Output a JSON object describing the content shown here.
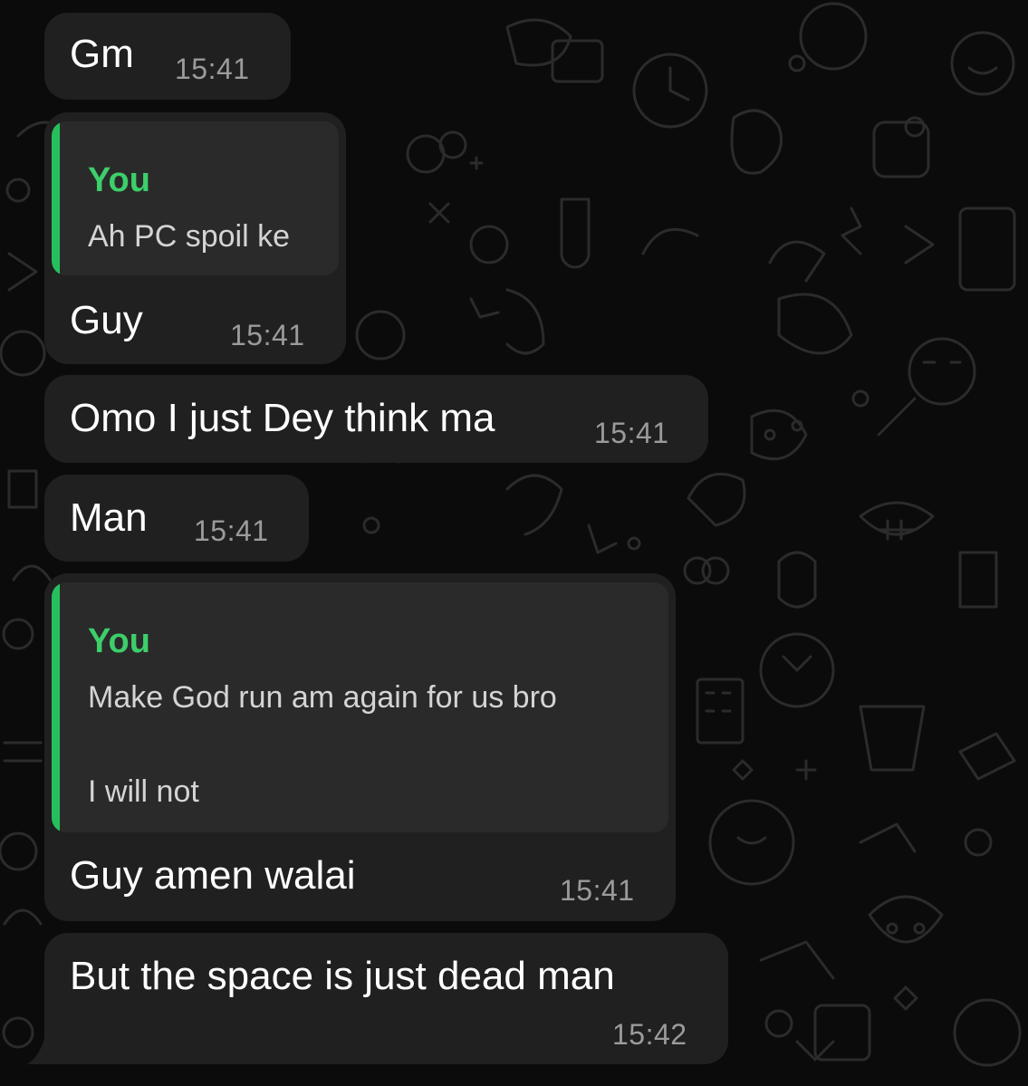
{
  "messages": [
    {
      "text": "Gm",
      "time": "15:41"
    },
    {
      "quote": {
        "author": "You",
        "text": "Ah PC spoil ke"
      },
      "text": "Guy",
      "time": "15:41"
    },
    {
      "text": "Omo I just Dey think ma",
      "time": "15:41"
    },
    {
      "text": "Man",
      "time": "15:41"
    },
    {
      "quote": {
        "author": "You",
        "lines": [
          "Make God run am again for us bro",
          "I will not"
        ]
      },
      "text": "Guy amen walai",
      "time": "15:41"
    },
    {
      "text": "But the space is just dead man",
      "time": "15:42"
    }
  ],
  "colors": {
    "background": "#0b0b0b",
    "bubble": "#202020",
    "quote_background": "#2a2a2a",
    "quote_accent": "#25c05d",
    "time": "#9b9b9b"
  },
  "icons": [
    "doodle-wallpaper-icons"
  ]
}
